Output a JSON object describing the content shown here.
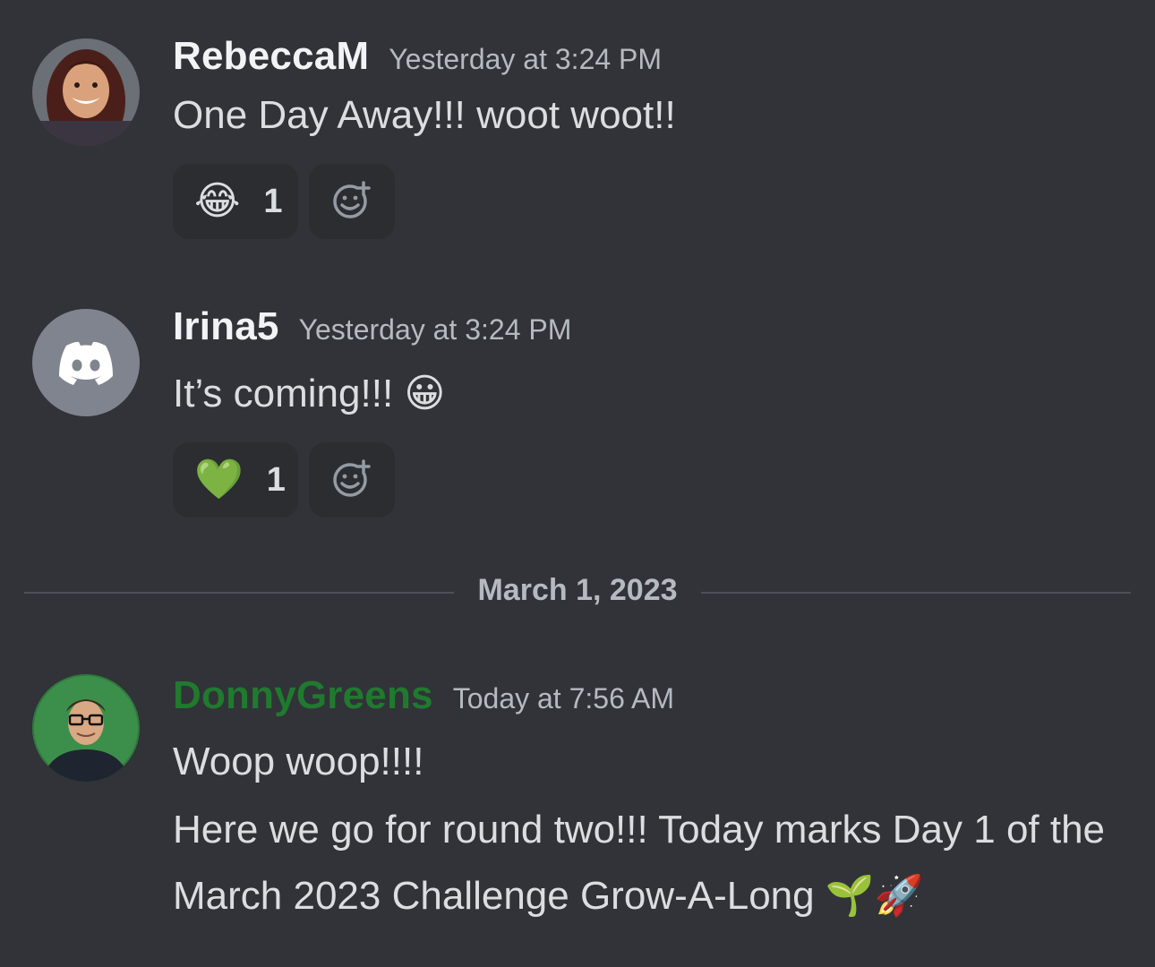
{
  "messages": [
    {
      "username": "RebeccaM",
      "timestamp": "Yesterday at 3:24 PM",
      "text": "One Day Away!!! woot woot!!",
      "reaction": {
        "emoji": "😂",
        "count": "1"
      }
    },
    {
      "username": "Irina5",
      "timestamp": "Yesterday at 3:24 PM",
      "text": "It’s coming!!!",
      "text_emoji": "😀",
      "reaction": {
        "emoji": "💚",
        "count": "1"
      }
    },
    {
      "username": "DonnyGreens",
      "timestamp": "Today at 7:56 AM",
      "line1": "Woop woop!!!!",
      "line2": "Here we go for round two!!! Today marks Day 1 of the",
      "line3": "March 2023 Challenge Grow-A-Long",
      "line3_emoji": "🌱🚀"
    }
  ],
  "date_divider": "March 1, 2023",
  "colors": {
    "background": "#313338",
    "reaction_bg": "#2b2d31",
    "donny_username": "#1f7a2e",
    "discord_default_avatar": "#80848e"
  },
  "icons": {
    "add_reaction": "add-reaction-icon",
    "discord_logo": "discord-logo-icon"
  }
}
